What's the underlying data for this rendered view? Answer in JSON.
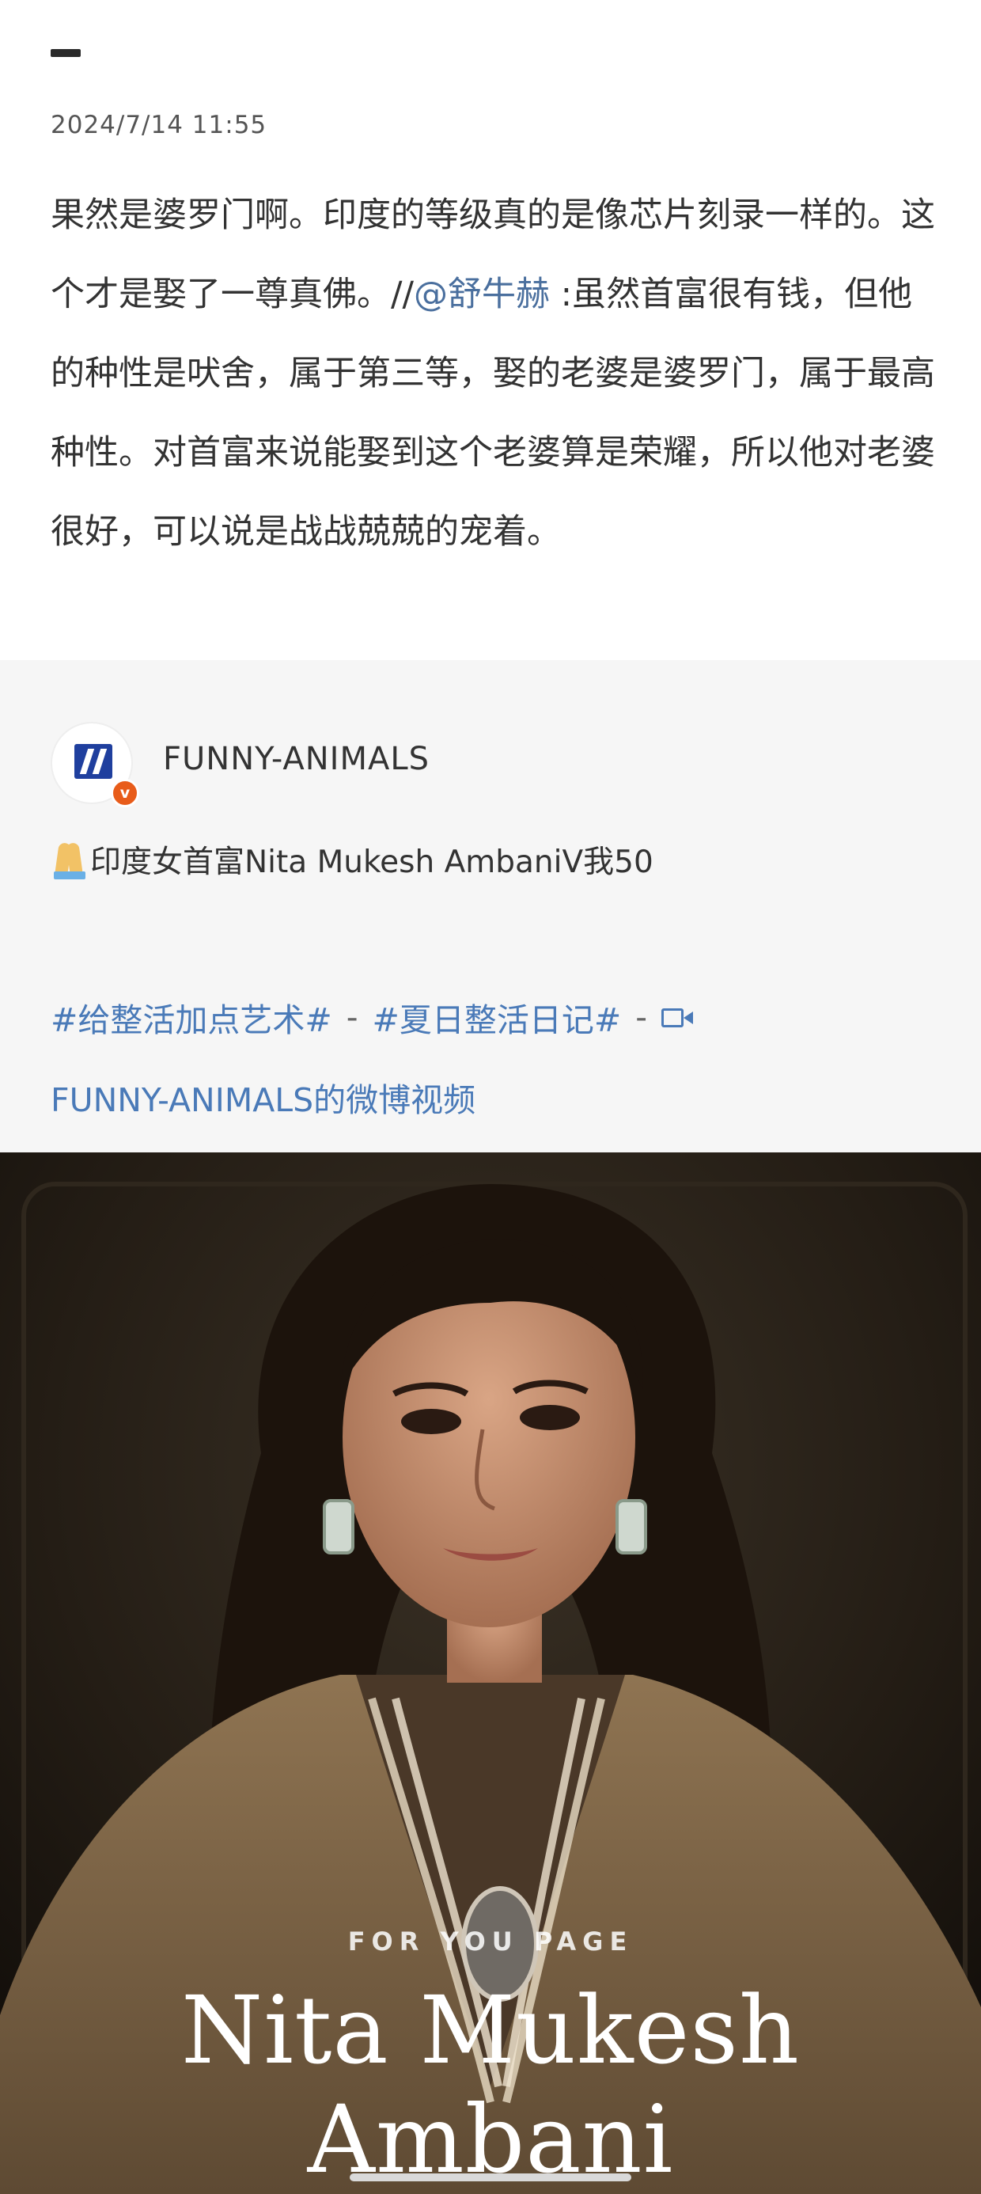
{
  "post": {
    "timestamp": "2024/7/14 11:55",
    "text_before_mention": "果然是婆罗门啊。印度的等级真的是像芯片刻录一样的。这个才是娶了一尊真佛。//",
    "mention": "@舒牛赫",
    "text_after_mention": " :虽然首富很有钱，但他的种性是吠舍，属于第三等，娶的老婆是婆罗门，属于最高种性。对首富来说能娶到这个老婆算是荣耀，所以他对老婆很好，可以说是战战兢兢的宠着。"
  },
  "repost": {
    "username": "FUNNY-ANIMALS",
    "verified_badge": "v",
    "caption": "印度女首富Nita Mukesh AmbaniV我50",
    "caption_icon": "pray-icon",
    "hashtags": [
      "#给整活加点艺术#",
      "#夏日整活日记#"
    ],
    "separator": "-",
    "video_source": "FUNNY-ANIMALS的微博视频"
  },
  "video": {
    "overlay_subtitle": "FOR YOU PAGE",
    "overlay_title": "Nita Mukesh Ambani"
  },
  "colors": {
    "link": "#4a7ab8",
    "mention": "#4a6f9e",
    "verified": "#e85c1a",
    "repost_bg": "#f6f6f6"
  }
}
